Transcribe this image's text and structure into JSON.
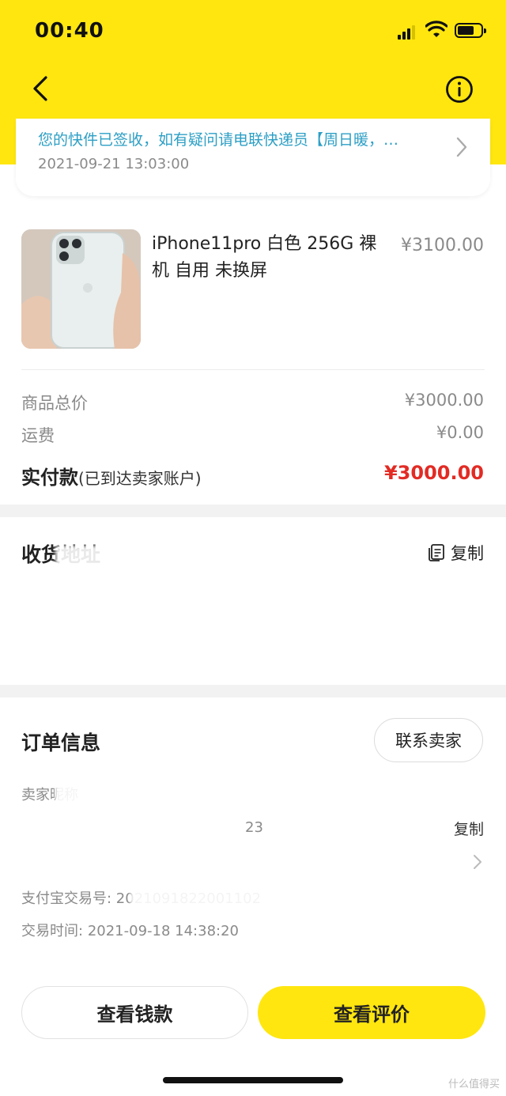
{
  "status_bar": {
    "time": "00:40"
  },
  "tracking": {
    "message": "您的快件已签收，如有疑问请电联快递员【周日暖，…",
    "time": "2021-09-21 13:03:00"
  },
  "product": {
    "title": "iPhone11pro 白色 256G 裸机 自用 未换屏",
    "price": "¥3100.00"
  },
  "costs": {
    "total_label": "商品总价",
    "total_value": "¥3000.00",
    "shipping_label": "运费",
    "shipping_value": "¥0.00",
    "paid_label": "实付款",
    "paid_note": "(已到达卖家账户)",
    "paid_value": "¥3000.00"
  },
  "address": {
    "title": "收货地址",
    "copy_label": "复制"
  },
  "order_info": {
    "title": "订单信息",
    "contact_label": "联系卖家",
    "seller_label": "卖家昵称",
    "order_no_fragment": "23",
    "copy_label": "复制",
    "alipay_label": "支付宝交易号: 2021091822001102",
    "trade_time_label": "交易时间:",
    "trade_time_value": "2021-09-18 14:38:20"
  },
  "actions": {
    "view_money": "查看钱款",
    "view_review": "查看评价"
  },
  "watermark": {
    "text": "什么值得买"
  },
  "colors": {
    "brand_yellow": "#ffe60f",
    "price_red": "#e22b24",
    "link_blue": "#2d9fc5"
  }
}
